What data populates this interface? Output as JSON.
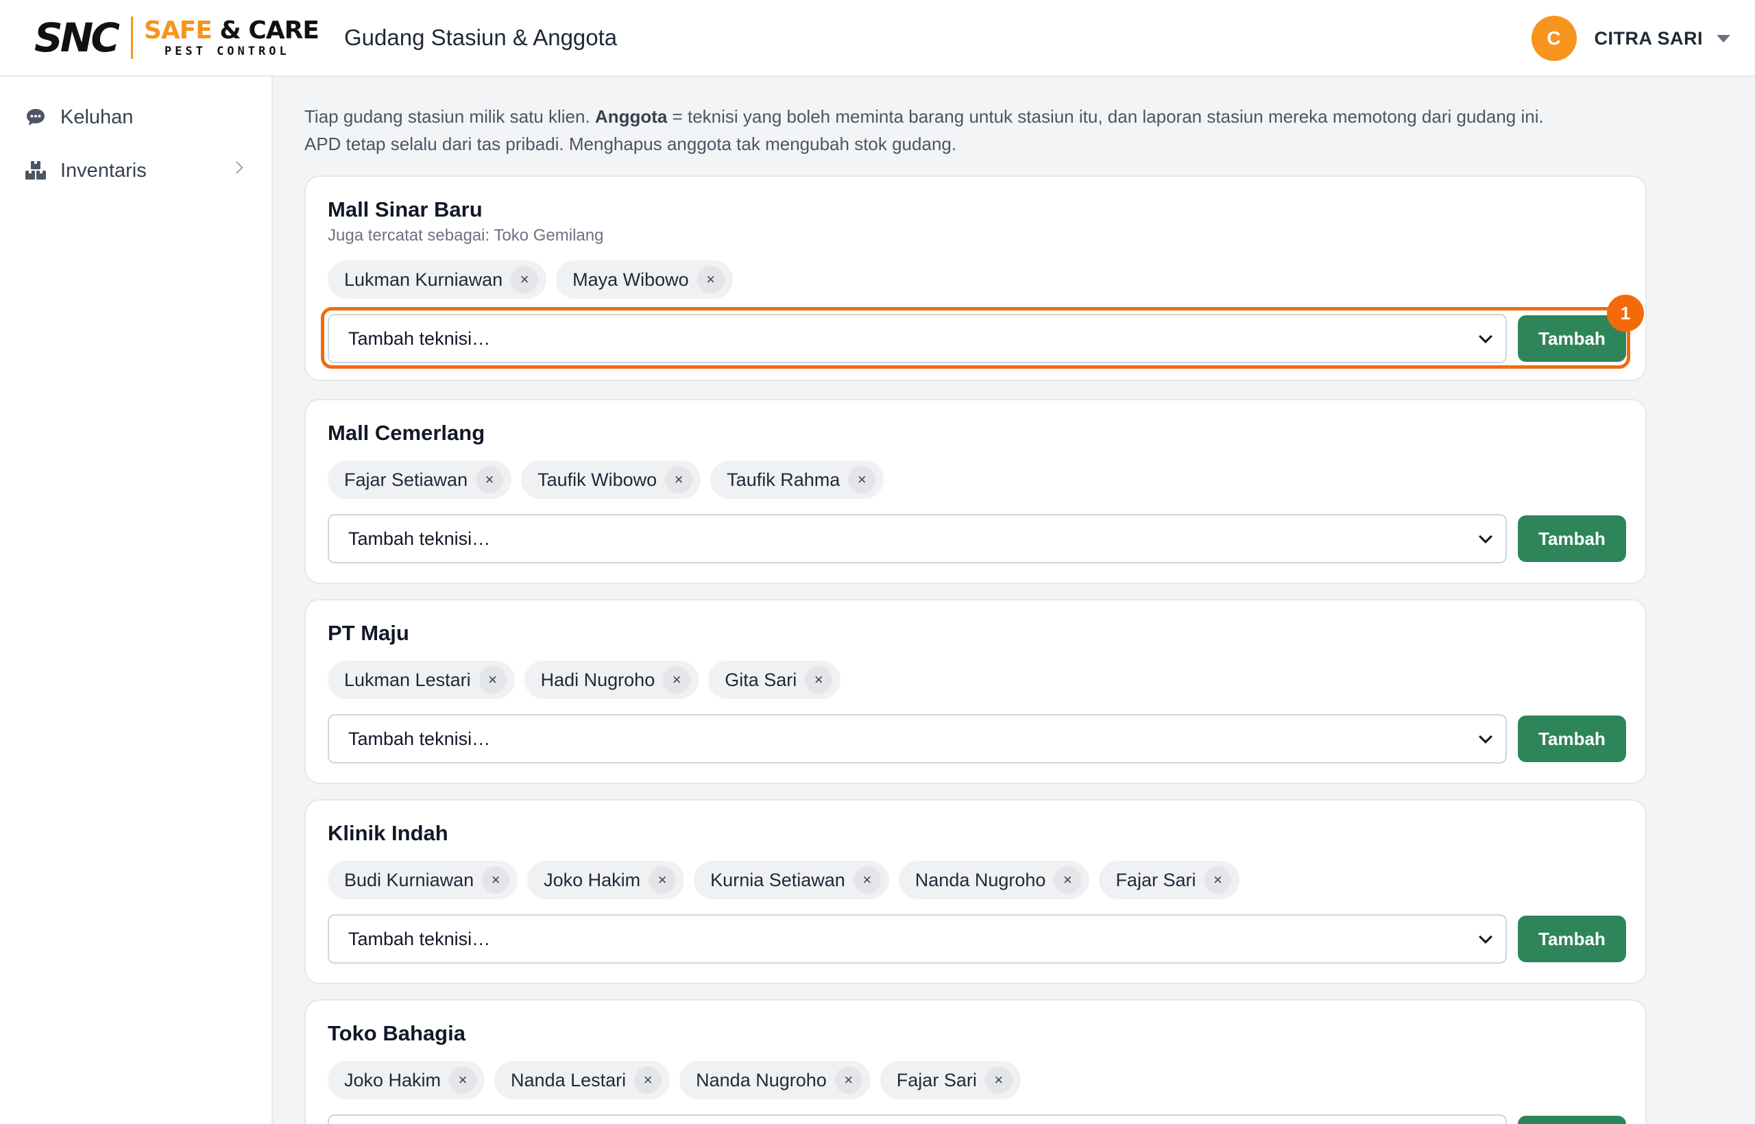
{
  "header": {
    "logo": {
      "mark": "SNC",
      "brand_a": "SAFE",
      "brand_amp": "&",
      "brand_b": "CARE",
      "tagline": "PEST CONTROL"
    },
    "title": "Gudang Stasiun & Anggota",
    "user": {
      "initial": "C",
      "name": "CITRA SARI"
    }
  },
  "sidebar": {
    "items": [
      {
        "label": "Keluhan",
        "icon": "chat-icon"
      },
      {
        "label": "Inventaris",
        "icon": "boxes-icon",
        "has_submenu": true
      }
    ]
  },
  "intro": {
    "part1": "Tiap gudang stasiun milik satu klien. ",
    "bold": "Anggota",
    "part2": " = teknisi yang boleh meminta barang untuk stasiun itu, dan laporan stasiun mereka memotong dari gudang ini.",
    "line2": "APD tetap selalu dari tas pribadi. Menghapus anggota tak mengubah stok gudang."
  },
  "select_placeholder": "Tambah teknisi…",
  "add_label": "Tambah",
  "remove_glyph": "×",
  "highlight_badge": "1",
  "stations": [
    {
      "name": "Mall Sinar Baru",
      "subtitle": "Juga tercatat sebagai: Toko Gemilang",
      "members": [
        "Lukman Kurniawan",
        "Maya Wibowo"
      ]
    },
    {
      "name": "Mall Cemerlang",
      "subtitle": "",
      "members": [
        "Fajar Setiawan",
        "Taufik Wibowo",
        "Taufik Rahma"
      ]
    },
    {
      "name": "PT Maju",
      "subtitle": "",
      "members": [
        "Lukman Lestari",
        "Hadi Nugroho",
        "Gita Sari"
      ]
    },
    {
      "name": "Klinik Indah",
      "subtitle": "",
      "members": [
        "Budi Kurniawan",
        "Joko Hakim",
        "Kurnia Setiawan",
        "Nanda Nugroho",
        "Fajar Sari"
      ]
    },
    {
      "name": "Toko Bahagia",
      "subtitle": "",
      "members": [
        "Joko Hakim",
        "Nanda Lestari",
        "Nanda Nugroho",
        "Fajar Sari"
      ]
    }
  ],
  "colors": {
    "accent": "#f7941d",
    "primary_button": "#2f855a",
    "highlight": "#f46a0b"
  }
}
